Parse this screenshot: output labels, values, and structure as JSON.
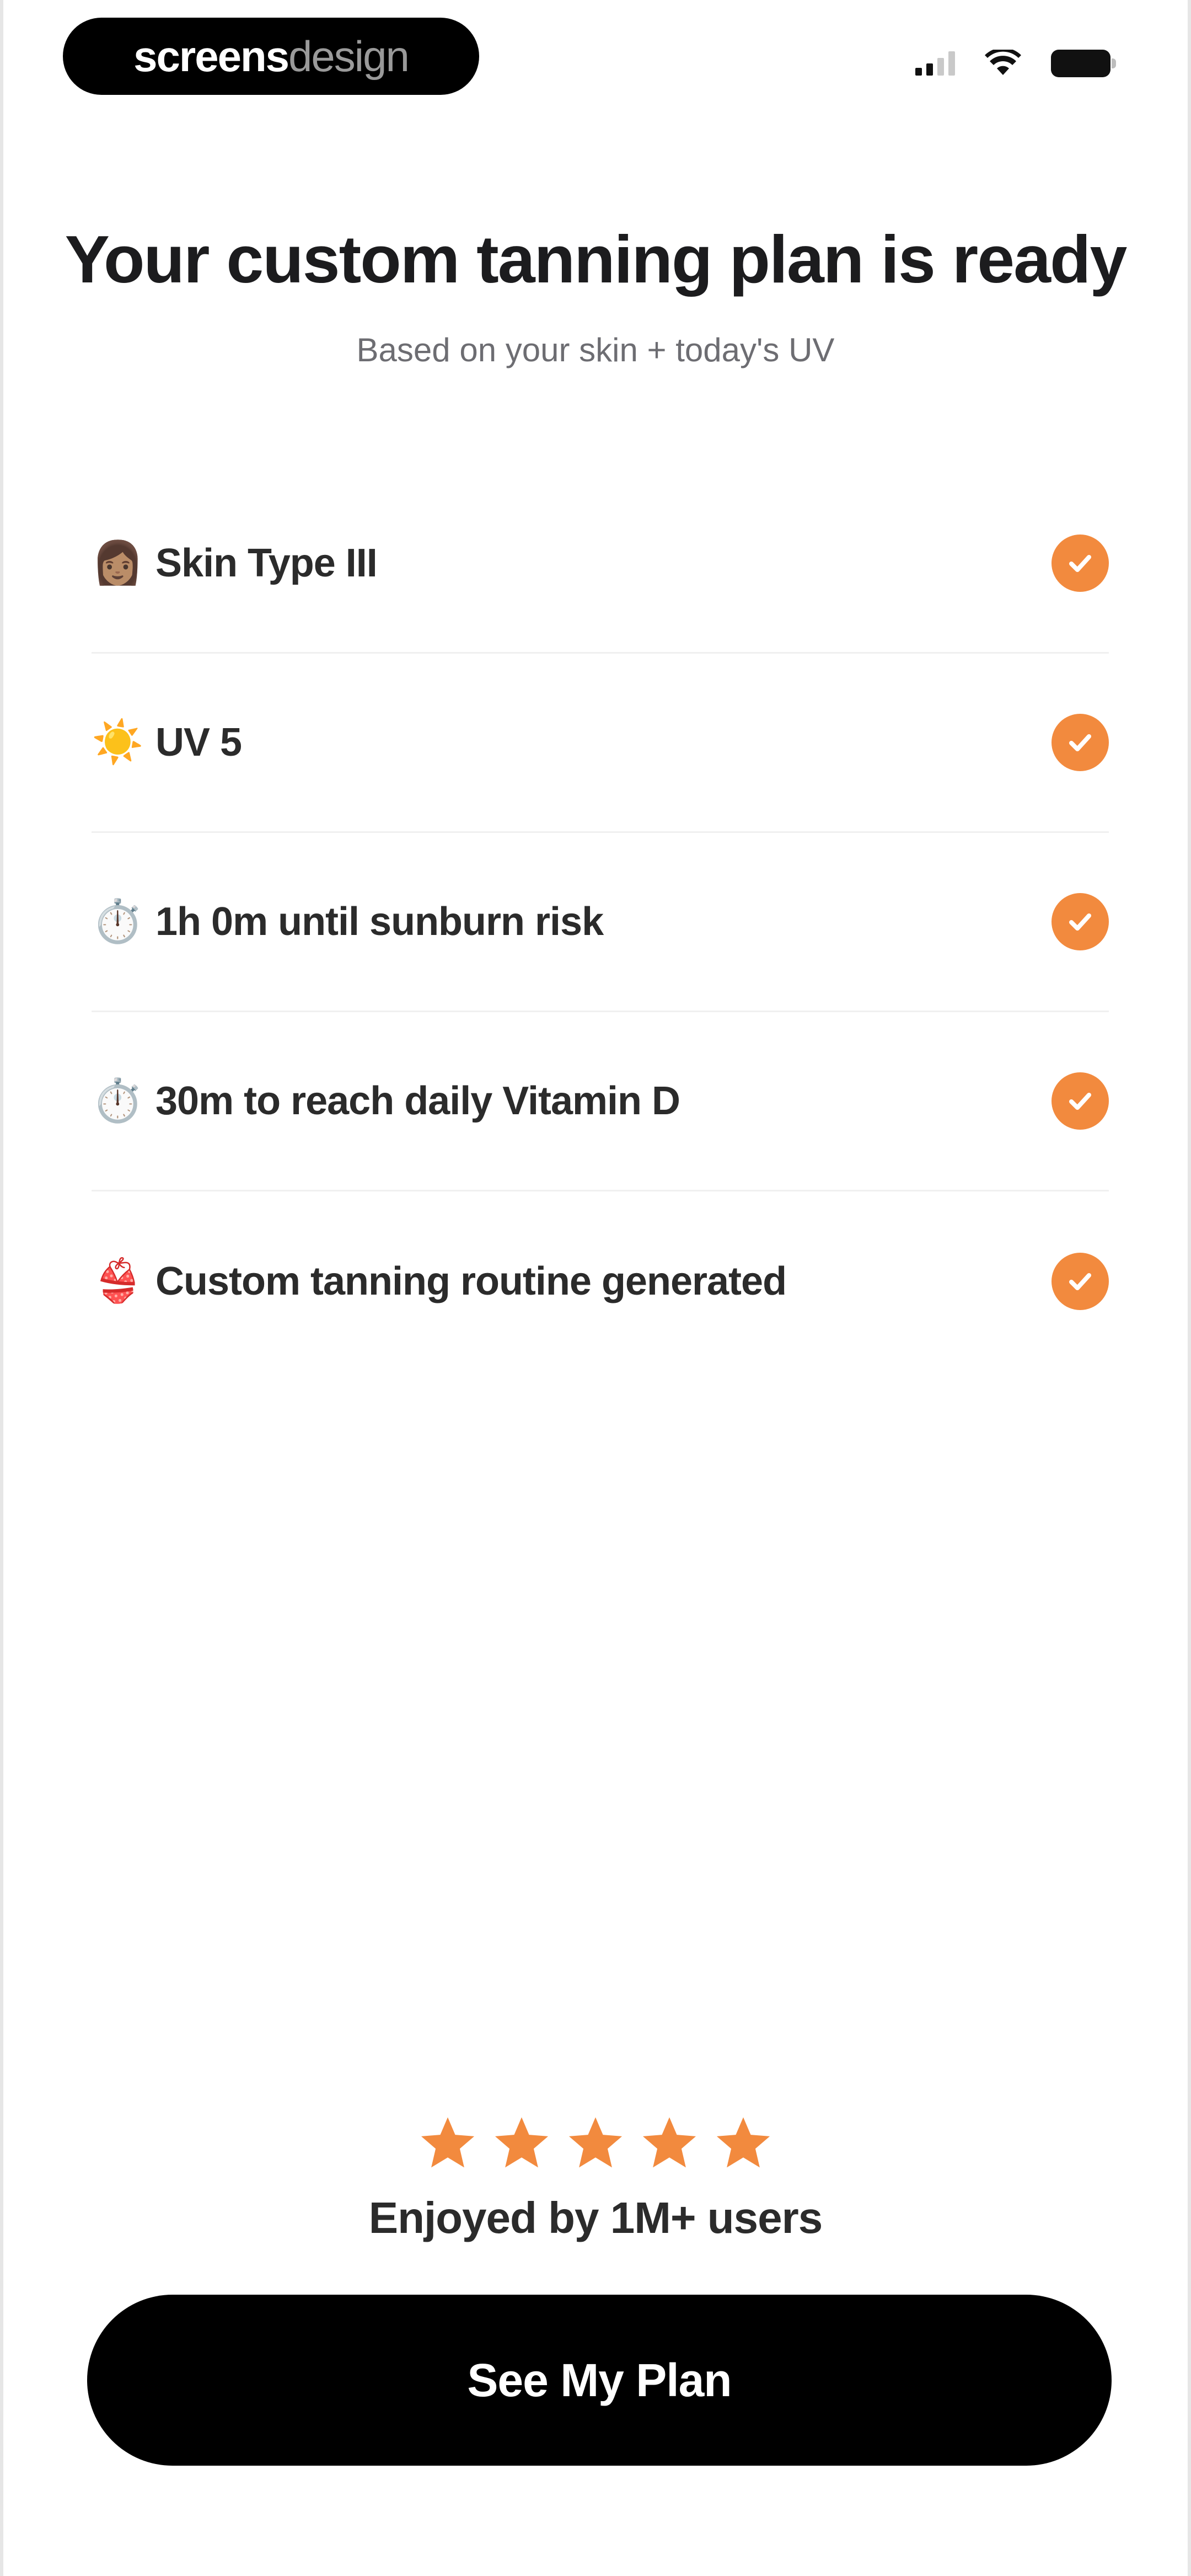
{
  "status_bar": {
    "brand_part1": "screens",
    "brand_part2": "design"
  },
  "header": {
    "title": "Your custom tanning plan is ready",
    "subtitle": "Based on your skin + today's UV"
  },
  "plan_items": [
    {
      "emoji": "👩🏽",
      "icon_name": "skin-tone-icon",
      "label": "Skin Type III"
    },
    {
      "emoji": "☀️",
      "icon_name": "sun-icon",
      "label": "UV 5"
    },
    {
      "emoji": "⏱️",
      "icon_name": "stopwatch-icon",
      "label": "1h 0m until sunburn risk"
    },
    {
      "emoji": "⏱️",
      "icon_name": "stopwatch-icon",
      "label": "30m to reach daily Vitamin D"
    },
    {
      "emoji": "👙",
      "icon_name": "bikini-icon",
      "label": "Custom tanning routine generated"
    }
  ],
  "rating": {
    "stars": 5,
    "text": "Enjoyed by 1M+ users"
  },
  "cta": {
    "label": "See My Plan"
  },
  "colors": {
    "accent": "#f28a3e",
    "button": "#000000",
    "text": "#1c1c1e",
    "muted": "#6d6d72"
  }
}
